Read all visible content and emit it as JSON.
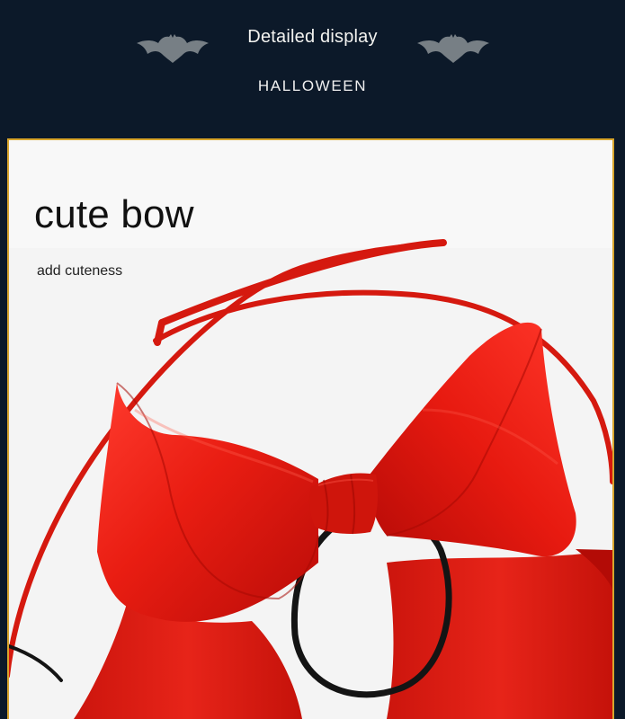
{
  "header": {
    "title": "Detailed display",
    "subtitle": "HALLOWEEN",
    "left_icon": "bat-icon",
    "right_icon": "bat-icon"
  },
  "photo": {
    "headline": "cute bow",
    "caption": "add cuteness",
    "subject": "red satin bow with black elastic loop",
    "colors": {
      "background": "#0c1929",
      "frame": "#d8a52c",
      "bow": "#d9150c",
      "elastic": "#141414"
    }
  }
}
